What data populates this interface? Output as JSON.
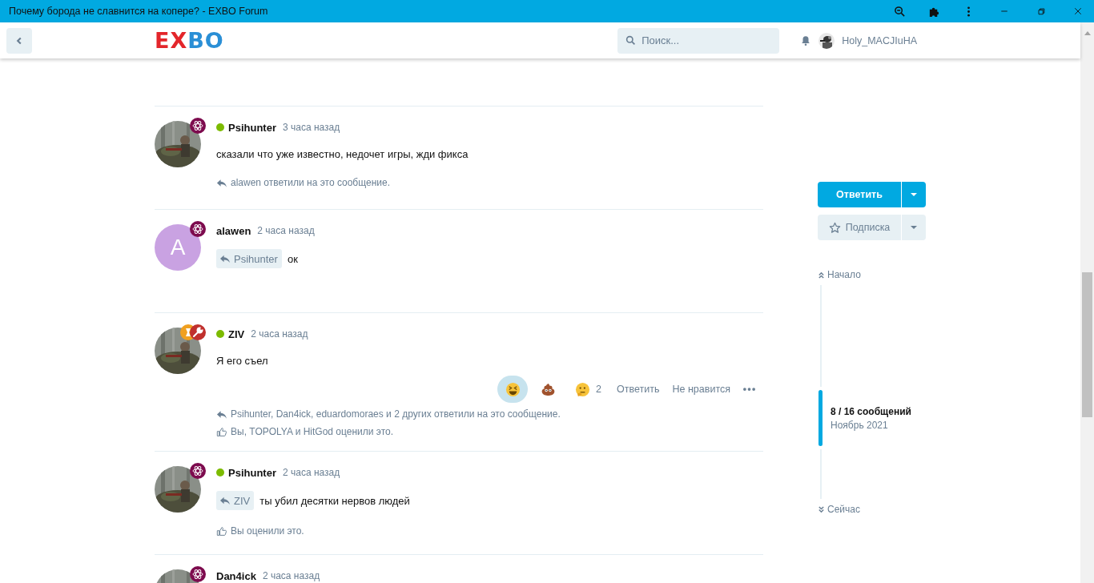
{
  "window": {
    "title": "Почему борода не славнится на копере? - EXBO Forum"
  },
  "header": {
    "logo": "EXBO",
    "search": {
      "placeholder": "Поиск..."
    },
    "user": {
      "name": "Holy_MACJIuHA"
    }
  },
  "posts": [
    {
      "author": "Psihunter",
      "online": true,
      "time": "3 часа назад",
      "avatar": {
        "kind": "picture"
      },
      "badges": [
        {
          "kind": "atom",
          "color": "#7d0b4e"
        }
      ],
      "body": "сказали что уже известно, недочет игры, жди фикса",
      "replies_note": "alawen ответили на это сообщение."
    },
    {
      "author": "alawen",
      "online": false,
      "time": "2 часа назад",
      "avatar": {
        "kind": "letter",
        "letter": "A",
        "color": "#c9a2e2"
      },
      "badges": [
        {
          "kind": "atom",
          "color": "#7d0b4e"
        }
      ],
      "mention": "Psihunter",
      "body": "ок"
    },
    {
      "author": "ZIV",
      "online": true,
      "time": "2 часа назад",
      "avatar": {
        "kind": "picture"
      },
      "badges": [
        {
          "kind": "other",
          "color": "#f0a020"
        },
        {
          "kind": "wrench",
          "color": "#c0302d"
        }
      ],
      "body": "Я его съел",
      "reactions": [
        {
          "kind": "laugh",
          "selected": true
        },
        {
          "kind": "poop",
          "selected": false
        },
        {
          "kind": "thinking",
          "selected": false,
          "count": "2"
        }
      ],
      "actions": [
        "Ответить",
        "Не нравится"
      ],
      "more_menu": true,
      "replies_note": "Psihunter, Dan4ick, eduardomoraes и 2 других ответили на это сообщение.",
      "likes_note": "Вы, TOPOLYA и HitGod оценили это."
    },
    {
      "author": "Psihunter",
      "online": true,
      "time": "2 часа назад",
      "avatar": {
        "kind": "picture"
      },
      "badges": [
        {
          "kind": "atom",
          "color": "#7d0b4e"
        }
      ],
      "mention": "ZIV",
      "body": "ты убил десятки нервов людей",
      "likes_note": "Вы оценили это."
    },
    {
      "author": "Dan4ick",
      "online": false,
      "time": "2 часа назад",
      "avatar": {
        "kind": "picture"
      },
      "badges": [
        {
          "kind": "atom",
          "color": "#7d0b4e"
        }
      ]
    }
  ],
  "sidebar": {
    "reply_button": "Ответить",
    "subscribe_button": "Подписка",
    "scrubber": {
      "start": "Начало",
      "position": "8 / 16 сообщений",
      "date": "Ноябрь 2021",
      "end": "Сейчас"
    }
  }
}
